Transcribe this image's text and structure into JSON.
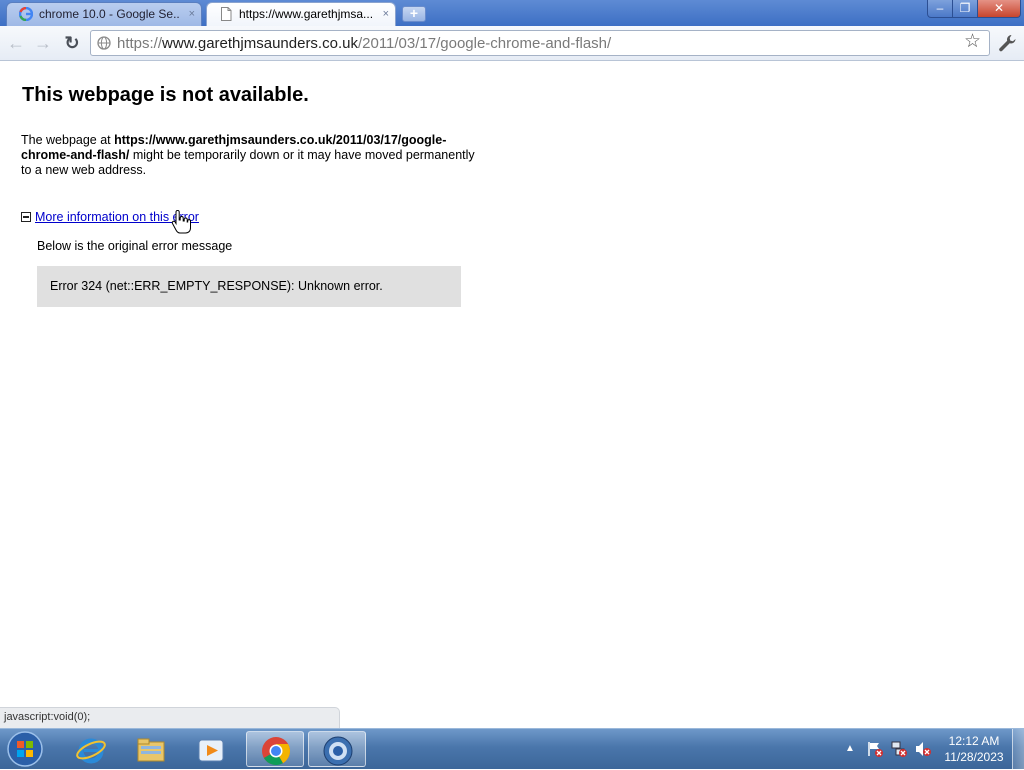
{
  "tabs": [
    {
      "label": "chrome 10.0 - Google Se...",
      "close": "×",
      "active": false,
      "icon": "google-g-icon"
    },
    {
      "label": "https://www.garethjmsa...",
      "close": "×",
      "active": true,
      "icon": "page-icon"
    }
  ],
  "new_tab": "+",
  "window_controls": {
    "minimize": "‒",
    "maximize": "❐",
    "close": "✕"
  },
  "toolbar": {
    "back_icon": "←",
    "forward_icon": "→",
    "reload_icon": "↻",
    "url_scheme": "https://",
    "url_host": "www.garethjmsaunders.co.uk",
    "url_path": "/2011/03/17/google-chrome-and-flash/",
    "star_icon": "☆"
  },
  "page": {
    "title": "This webpage is not available.",
    "desc_prefix": "The webpage at ",
    "desc_url": "https://www.garethjmsaunders.co.uk/2011/03/17/google-chrome-and-flash/",
    "desc_suffix": " might be temporarily down or it may have moved permanently to a new web address.",
    "more_info_link": "More information on this error",
    "below_text": "Below is the original error message",
    "error_message": "Error 324 (net::ERR_EMPTY_RESPONSE): Unknown error."
  },
  "status_bubble": "javascript:void(0);",
  "taskbar": {
    "items": [
      "start-orb-icon",
      "internet-explorer-icon",
      "windows-explorer-icon",
      "media-player-icon",
      "chrome-icon",
      "chrome-beta-icon"
    ],
    "tray_chevron": "▲",
    "clock_time": "12:12 AM",
    "clock_date": "11/28/2023"
  },
  "colors": {
    "accent": "#3d6fc4",
    "link": "#0000cc",
    "error_box": "#e0e0e0",
    "taskbar": "#4a76ab"
  }
}
